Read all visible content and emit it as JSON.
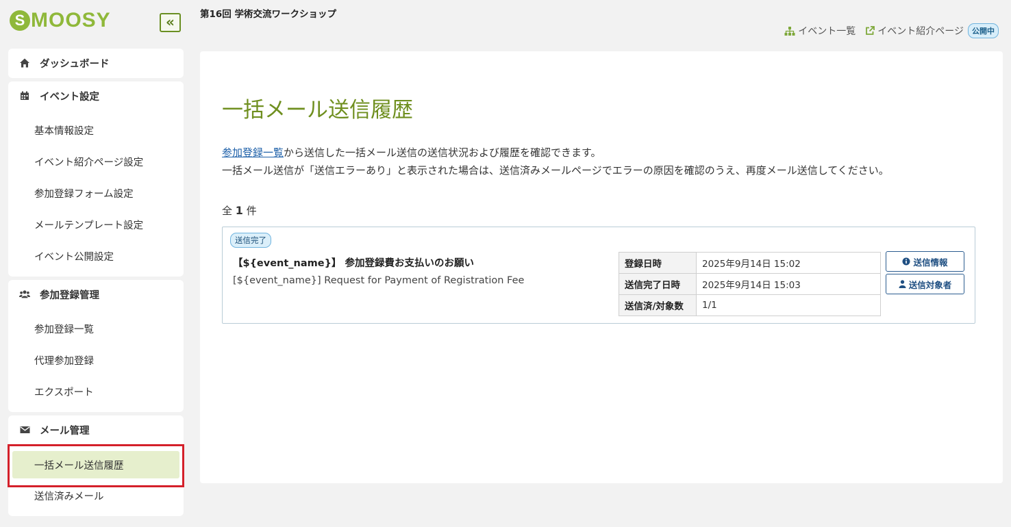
{
  "app": {
    "logo_letter": "S",
    "logo_text": "MOOSY",
    "brand_color": "#8fb83a"
  },
  "sidebar": {
    "collapse_label": "«",
    "groups": [
      {
        "label": "ダッシュボード",
        "icon": "home-icon",
        "items": []
      },
      {
        "label": "イベント設定",
        "icon": "calendar-icon",
        "items": [
          "基本情報設定",
          "イベント紹介ページ設定",
          "参加登録フォーム設定",
          "メールテンプレート設定",
          "イベント公開設定"
        ]
      },
      {
        "label": "参加登録管理",
        "icon": "users-icon",
        "items": [
          "参加登録一覧",
          "代理参加登録",
          "エクスポート"
        ]
      },
      {
        "label": "メール管理",
        "icon": "envelope-icon",
        "items": [
          "一括メール送信履歴",
          "送信済みメール"
        ]
      }
    ],
    "active_item": "一括メール送信履歴"
  },
  "header": {
    "event_title": "第16回 学術交流ワークショップ",
    "link_events": "イベント一覧",
    "link_intro": "イベント紹介ページ",
    "publish_badge": "公開中"
  },
  "main": {
    "title": "一括メール送信履歴",
    "desc_link": "参加登録一覧",
    "desc_line1_rest": "から送信した一括メール送信の送信状況および履歴を確認できます。",
    "desc_line2": "一括メール送信が「送信エラーあり」と表示された場合は、送信済みメールページでエラーの原因を確認のうえ、再度メール送信してください。",
    "count_prefix": "全",
    "count_value": "1",
    "count_suffix": "件",
    "records": [
      {
        "status": "送信完了",
        "subject": "【${event_name}】 参加登録費お支払いのお願い",
        "subject_en": "[${event_name}] Request for Payment of Registration Fee",
        "info": [
          {
            "key": "登録日時",
            "value": "2025年9月14日 15:02"
          },
          {
            "key": "送信完了日時",
            "value": "2025年9月14日 15:03"
          },
          {
            "key": "送信済/対象数",
            "value": "1/1"
          }
        ],
        "btn_info": "送信情報",
        "btn_targets": "送信対象者"
      }
    ]
  }
}
